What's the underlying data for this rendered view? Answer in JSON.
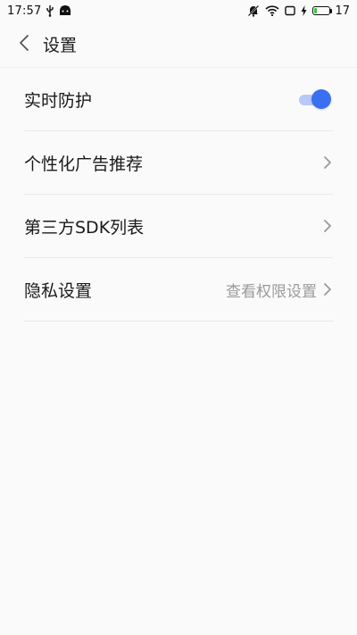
{
  "status_bar": {
    "time": "17:57",
    "battery_level": "17",
    "battery_fill_fraction": 0.17,
    "icons": [
      "usb-icon",
      "android-icon",
      "notifications-off-icon",
      "wifi-icon",
      "screen-icon",
      "charging-icon",
      "battery-icon"
    ]
  },
  "header": {
    "back_icon": "chevron-left-icon",
    "title": "设置"
  },
  "settings": {
    "items": [
      {
        "label": "实时防护",
        "control": "toggle",
        "toggle_on": true
      },
      {
        "label": "个性化广告推荐",
        "control": "chevron"
      },
      {
        "label": "第三方SDK列表",
        "control": "chevron"
      },
      {
        "label": "隐私设置",
        "hint": "查看权限设置",
        "control": "chevron"
      }
    ]
  },
  "colors": {
    "accent": "#3b6ff2",
    "accent_track": "#b7c9f7",
    "background": "#fafafa",
    "hint_text": "#9a9a9a",
    "battery": "#3cc13b"
  }
}
